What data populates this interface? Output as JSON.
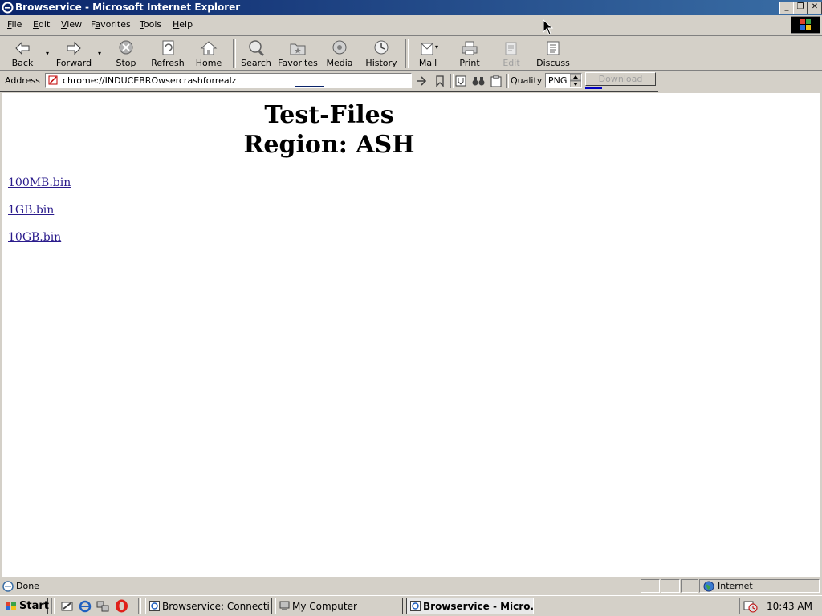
{
  "window": {
    "title": "Browservice - Microsoft Internet Explorer",
    "caption_minimize": "_",
    "caption_restore": "❐",
    "caption_close": "✕"
  },
  "menu": [
    "File",
    "Edit",
    "View",
    "Favorites",
    "Tools",
    "Help"
  ],
  "menu_underline": [
    "F",
    "E",
    "V",
    "a",
    "T",
    "H"
  ],
  "toolbar": {
    "back": "Back",
    "forward": "Forward",
    "stop": "Stop",
    "refresh": "Refresh",
    "home": "Home",
    "search": "Search",
    "favorites": "Favorites",
    "media": "Media",
    "history": "History",
    "mail": "Mail",
    "print": "Print",
    "edit": "Edit",
    "discuss": "Discuss"
  },
  "address": {
    "label": "Address",
    "url": "chrome://INDUCEBROwsercrashforrealz",
    "quality_label": "Quality",
    "quality_value": "PNG",
    "download_label": "Download"
  },
  "content": {
    "heading_line1": "Test-Files",
    "heading_line2": "Region: ASH",
    "links": [
      "100MB.bin",
      "1GB.bin",
      "10GB.bin"
    ]
  },
  "status": {
    "text": "Done",
    "zone": "Internet"
  },
  "taskbar": {
    "start": "Start",
    "tasks": [
      {
        "label": "Browservice: Connecti...",
        "active": false
      },
      {
        "label": "My Computer",
        "active": false
      },
      {
        "label": "Browservice - Micro...",
        "active": true
      }
    ],
    "clock": "10:43 AM"
  },
  "colors": {
    "titlebar_start": "#0a246a",
    "titlebar_end": "#3a6ea5",
    "link": "#2a1b8c",
    "chrome": "#d4d0c8"
  }
}
